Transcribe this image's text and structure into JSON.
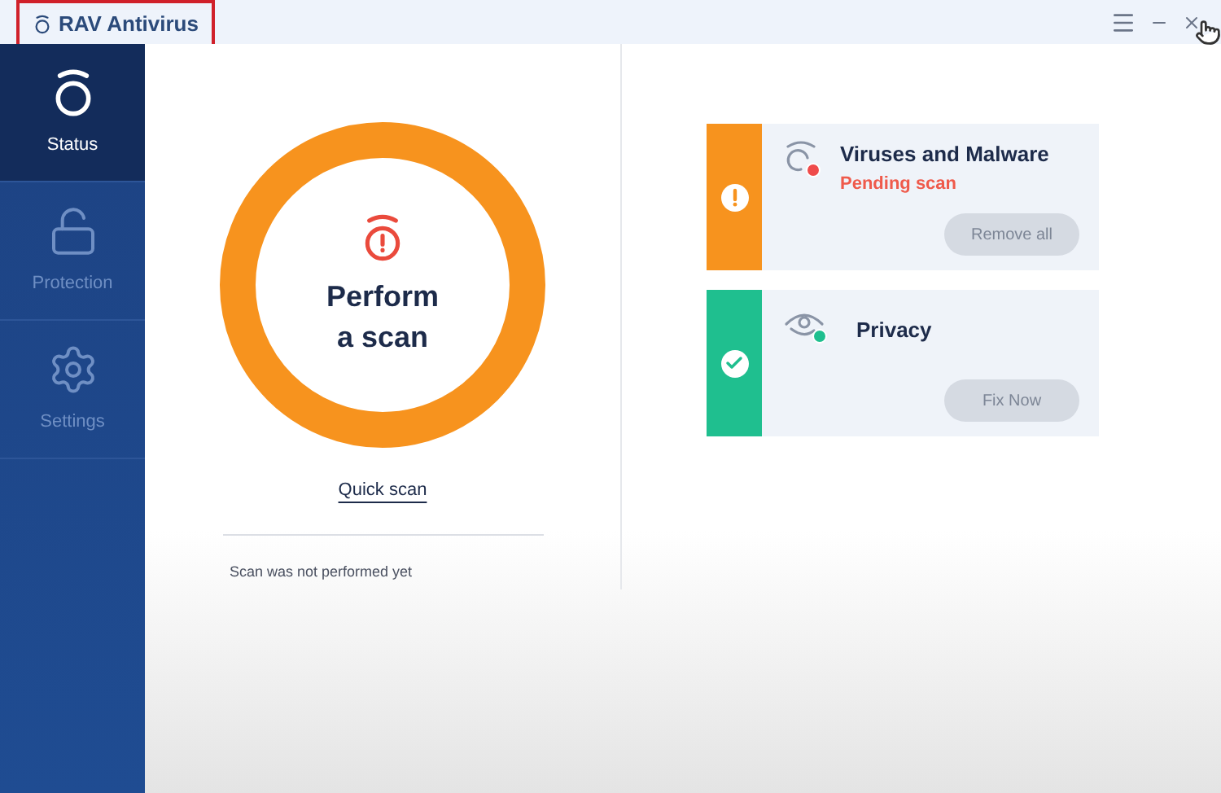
{
  "window": {
    "title": "RAV Antivirus",
    "title_highlighted": true
  },
  "sidebar": {
    "items": [
      {
        "label": "Status",
        "kind": "status",
        "selected": true
      },
      {
        "label": "Protection",
        "kind": "lock",
        "selected": false
      },
      {
        "label": "Settings",
        "kind": "gear",
        "selected": false
      }
    ]
  },
  "scan": {
    "title_lines": [
      "Perform",
      "a scan"
    ],
    "link": "Quick scan",
    "note": "Scan was not performed yet"
  },
  "cards": [
    {
      "title": "Viruses and Malware",
      "subtitle": "Pending scan",
      "kind": "warning",
      "button": "Remove all",
      "disabled": true
    },
    {
      "title": "Privacy",
      "kind": "ok",
      "button": "Fix Now",
      "disabled": true
    }
  ]
}
